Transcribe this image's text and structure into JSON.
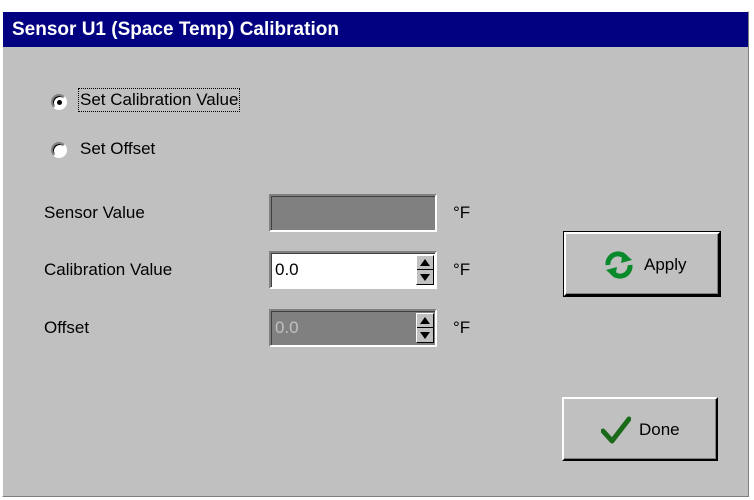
{
  "dialog": {
    "title": "Sensor U1 (Space Temp) Calibration"
  },
  "mode": {
    "options": [
      {
        "label": "Set Calibration Value",
        "selected": true
      },
      {
        "label": "Set Offset",
        "selected": false
      }
    ]
  },
  "fields": {
    "sensor_value": {
      "label": "Sensor Value",
      "value": "",
      "unit": "°F"
    },
    "calibration_value": {
      "label": "Calibration Value",
      "value": "0.0",
      "unit": "°F"
    },
    "offset": {
      "label": "Offset",
      "value": "0.0",
      "unit": "°F"
    }
  },
  "buttons": {
    "apply": {
      "label": "Apply"
    },
    "done": {
      "label": "Done"
    }
  },
  "colors": {
    "titlebar": "#000080",
    "face": "#c0c0c0",
    "disabled_field": "#808080",
    "apply_icon": "#0a8a2a",
    "done_icon": "#1a6a1a"
  }
}
